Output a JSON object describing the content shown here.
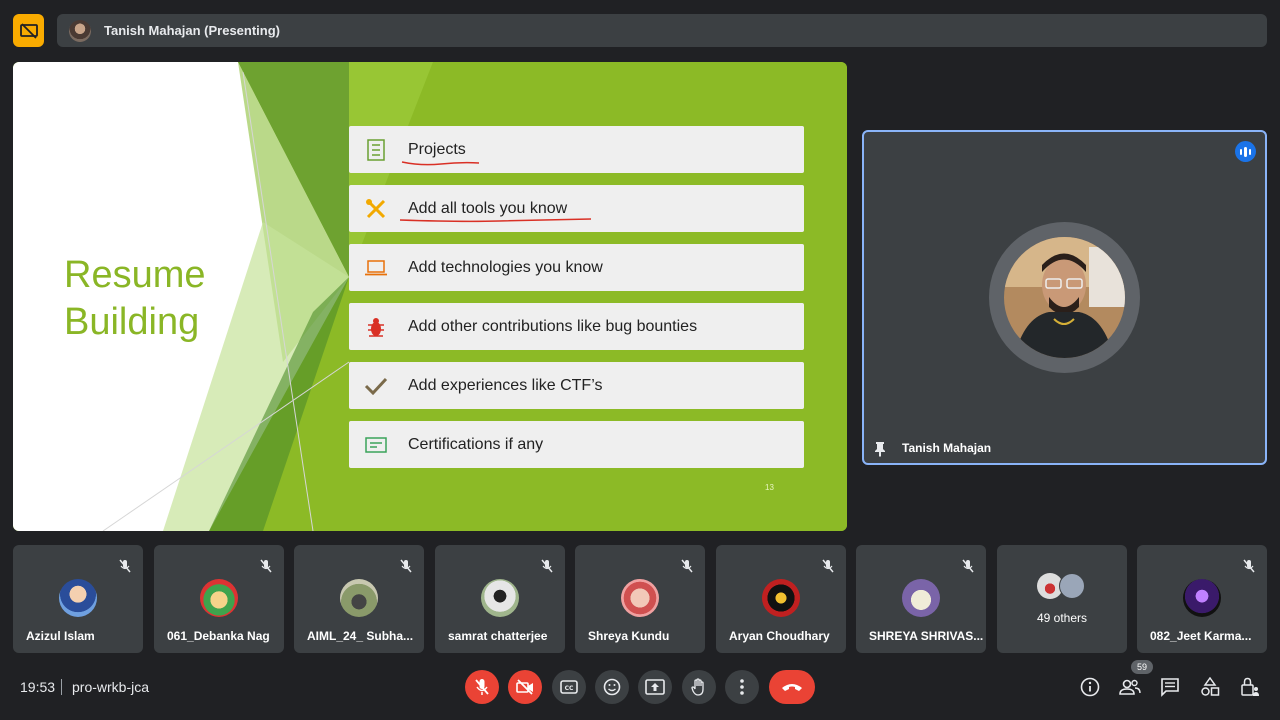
{
  "header": {
    "presenter_label": "Tanish Mahajan (Presenting)"
  },
  "slide": {
    "title_line1": "Resume",
    "title_line2": "Building",
    "bullets": [
      "Projects",
      "Add all tools you know",
      "Add technologies you know",
      "Add other contributions like bug bounties",
      "Add experiences like CTF’s",
      "Certifications if any"
    ],
    "slide_number": "13",
    "colors": {
      "accent": "#8cba26",
      "title": "#8ab626",
      "underline": "#d93025"
    }
  },
  "main_tile": {
    "name": "Tanish Mahajan",
    "highlight_color": "#8ab4f8"
  },
  "participants": [
    "Azizul Islam",
    "061_Debanka Nag",
    "AIML_24_ Subha...",
    "samrat chatterjee",
    "Shreya Kundu",
    "Aryan Choudhary",
    "SHREYA SHRIVAS...",
    "082_Jeet Karma..."
  ],
  "others_label": "49 others",
  "footer": {
    "time": "19:53",
    "meeting_code": "pro-wrkb-jca",
    "people_count": "59"
  }
}
